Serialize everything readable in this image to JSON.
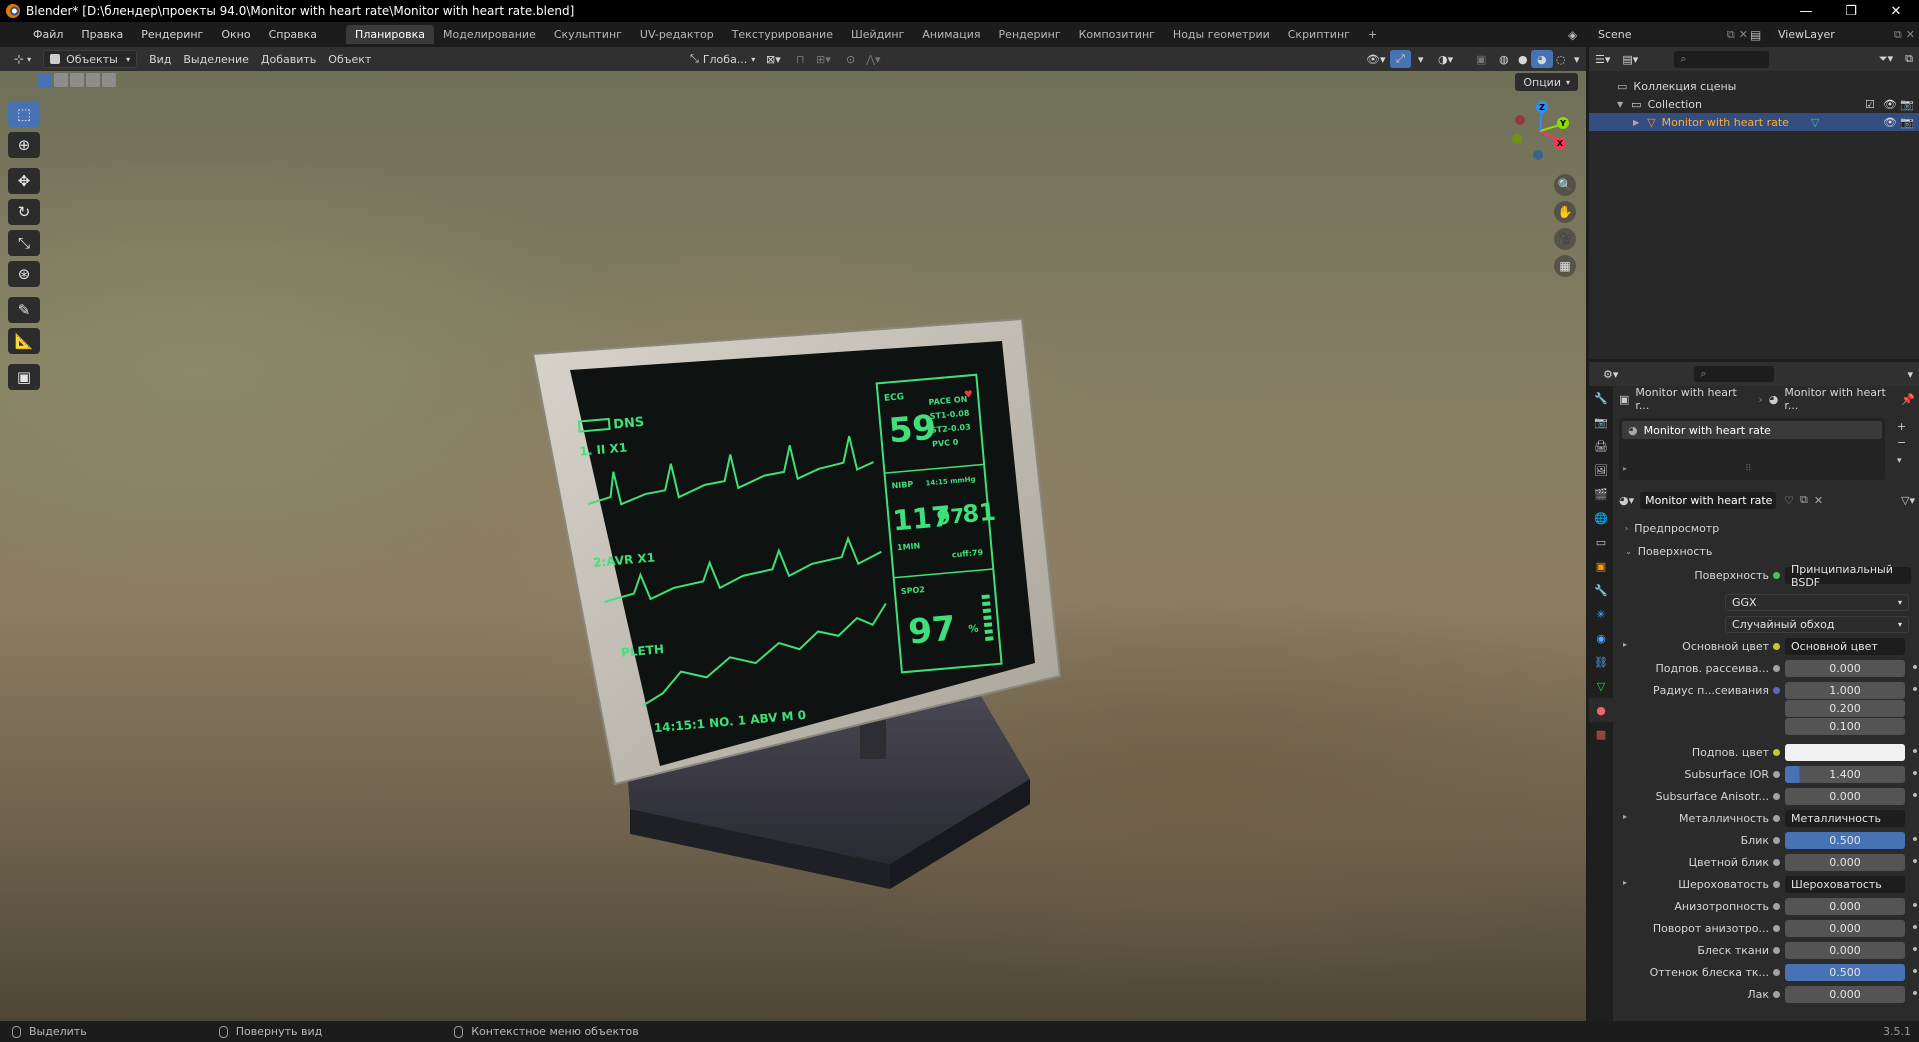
{
  "window": {
    "title": "Blender* [D:\\блендер\\проекты 94.0\\Monitor with heart rate\\Monitor with heart rate.blend]",
    "minimize": "—",
    "maximize": "❐",
    "close": "✕"
  },
  "menu": [
    "Файл",
    "Правка",
    "Рендеринг",
    "Окно",
    "Справка"
  ],
  "workspaces": [
    {
      "label": "Планировка",
      "active": true
    },
    {
      "label": "Моделирование"
    },
    {
      "label": "Скульптинг"
    },
    {
      "label": "UV-редактор"
    },
    {
      "label": "Текстурирование"
    },
    {
      "label": "Шейдинг"
    },
    {
      "label": "Анимация"
    },
    {
      "label": "Рендеринг"
    },
    {
      "label": "Композитинг"
    },
    {
      "label": "Ноды геометрии"
    },
    {
      "label": "Скриптинг"
    },
    {
      "label": "+"
    }
  ],
  "scene": {
    "name": "Scene",
    "view_layer": "ViewLayer"
  },
  "viewport_header": {
    "mode": "Объекты",
    "menus": [
      "Вид",
      "Выделение",
      "Добавить",
      "Объект"
    ],
    "transform_orientation": "Глоба...",
    "options": "Опции"
  },
  "axes": {
    "x": "X",
    "y": "Y",
    "z": "Z"
  },
  "monitor_screen": {
    "battery": "DNS",
    "lead_1": "1.   II     X1",
    "lead_2": "2:AVR   X1",
    "pleth": "PLETH",
    "bottom": "14:15:1   NO. 1   ABV  M 0",
    "ecg_label": "ECG",
    "hr": "59",
    "pace": "PACE ON",
    "st1": "ST1-0.08",
    "st2": "ST2-0.03",
    "pvc": "PVC 0",
    "nibp": "NIBP",
    "nibp_time": "14:15 mmHg",
    "sys": "117",
    "dia": "97",
    "map": "81",
    "min": "1MIN",
    "cuff": "cuff:79",
    "spo2_label": "SPO2",
    "spo2": "97",
    "percent": "%"
  },
  "outliner": {
    "root": "Коллекция сцены",
    "collection": "Collection",
    "object": "Monitor with heart rate"
  },
  "properties": {
    "breadcrumb_object": "Monitor with heart r...",
    "breadcrumb_material": "Monitor with heart r...",
    "slot": "Monitor with heart rate",
    "material_name": "Monitor with heart rate",
    "sections": {
      "preview": "Предпросмотр",
      "surface": "Поверхность"
    },
    "surface_label": "Поверхность",
    "surface_value": "Принципиальный BSDF",
    "distribution": "GGX",
    "subsurface_method": "Случайный обход",
    "rows": [
      {
        "label": "Основной цвет",
        "value": "Основной цвет",
        "kind": "link"
      },
      {
        "label": "Подпов. рассеива...",
        "value": "0.000",
        "kind": "num"
      },
      {
        "label": "Радиус п...сеивания",
        "value": "1.000",
        "kind": "num"
      },
      {
        "label": "",
        "value": "0.200",
        "kind": "num"
      },
      {
        "label": "",
        "value": "0.100",
        "kind": "num"
      },
      {
        "label": "Подпов. цвет",
        "value": "",
        "kind": "color"
      },
      {
        "label": "Subsurface IOR",
        "value": "1.400",
        "kind": "num"
      },
      {
        "label": "Subsurface Anisotr...",
        "value": "0.000",
        "kind": "num"
      },
      {
        "label": "Металличность",
        "value": "Металличность",
        "kind": "link"
      },
      {
        "label": "Блик",
        "value": "0.500",
        "kind": "bar",
        "fill": 0.5
      },
      {
        "label": "Цветной блик",
        "value": "0.000",
        "kind": "num"
      },
      {
        "label": "Шероховатость",
        "value": "Шероховатость",
        "kind": "link"
      },
      {
        "label": "Анизотропность",
        "value": "0.000",
        "kind": "num"
      },
      {
        "label": "Поворот анизотро...",
        "value": "0.000",
        "kind": "num"
      },
      {
        "label": "Блеск ткани",
        "value": "0.000",
        "kind": "num"
      },
      {
        "label": "Оттенок блеска тк...",
        "value": "0.500",
        "kind": "bar",
        "fill": 0.5
      },
      {
        "label": "Лак",
        "value": "0.000",
        "kind": "num"
      }
    ]
  },
  "statusbar": {
    "select": "Выделить",
    "rotate": "Повернуть вид",
    "context": "Контекстное меню объектов",
    "version": "3.5.1"
  },
  "colors": {
    "accent": "#4772b3",
    "selected_text": "#ffaf29",
    "screen_green": "#3fe07a"
  }
}
